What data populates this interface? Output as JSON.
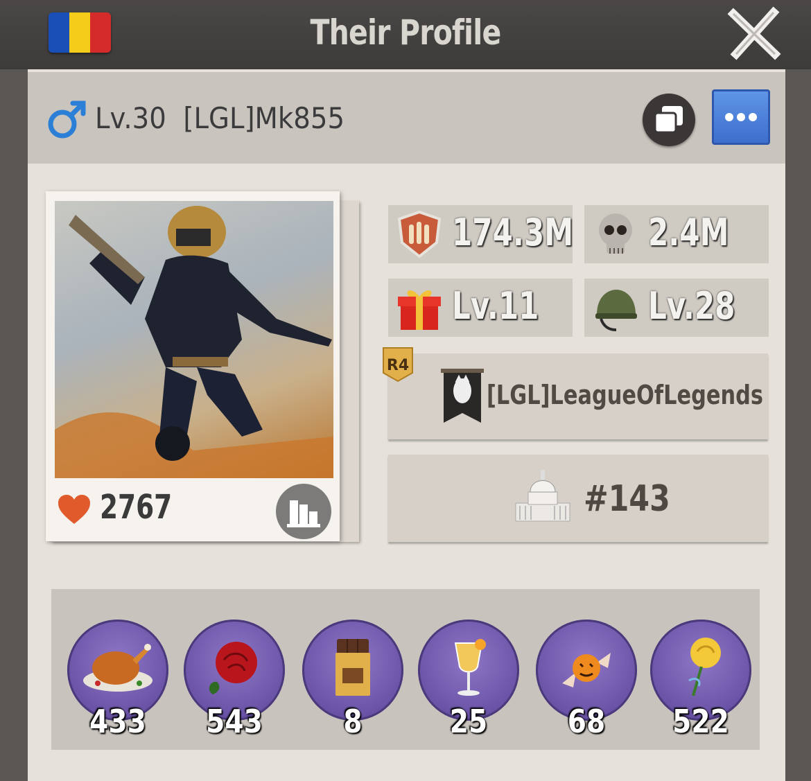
{
  "header": {
    "title": "Their Profile",
    "flag_colors": [
      "#1a4fb7",
      "#f6cc1a",
      "#d52b2b"
    ]
  },
  "player": {
    "gender_icon": "male-symbol",
    "name_line": "Lv.30  [LGL]Mk855",
    "likes": "2767"
  },
  "stats": {
    "power": "174.3M",
    "kills": "2.4M",
    "gift_level": "Lv.11",
    "helmet_level": "Lv.28"
  },
  "alliance": {
    "rank_badge": "R4",
    "name": "[LGL]LeagueOfLegends"
  },
  "capitol": {
    "rank": "#143"
  },
  "gifts": [
    {
      "icon": "roast-turkey",
      "count": "433"
    },
    {
      "icon": "red-rose",
      "count": "543"
    },
    {
      "icon": "chocolate-bar",
      "count": "8"
    },
    {
      "icon": "cocktail-glass",
      "count": "25"
    },
    {
      "icon": "halloween-candy",
      "count": "68"
    },
    {
      "icon": "yellow-rose",
      "count": "522"
    }
  ],
  "colors": {
    "accent_blue": "#3d6fce",
    "gift_purple": "#6a52a6"
  }
}
